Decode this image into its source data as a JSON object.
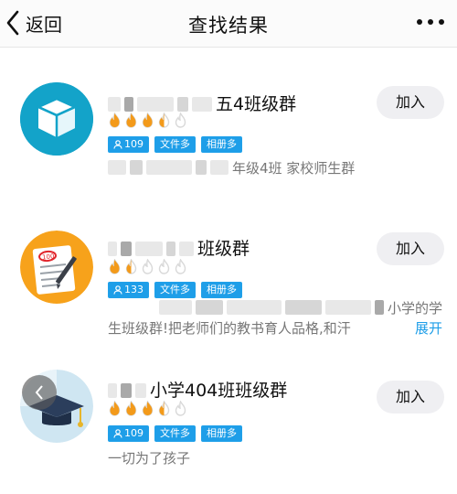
{
  "header": {
    "back_label": "返回",
    "title": "查找结果"
  },
  "groups": [
    {
      "name_visible": "五4班级群",
      "rating_filled": 3.5,
      "rating_max": 5,
      "member_count": "109",
      "tag_files": "文件多",
      "tag_album": "相册多",
      "desc_visible": "年级4班 家校师生群",
      "join_label": "加入",
      "avatar_icon": "open-box-icon"
    },
    {
      "name_visible": "班级群",
      "rating_filled": 1.5,
      "rating_max": 5,
      "member_count": "133",
      "tag_files": "文件多",
      "tag_album": "相册多",
      "desc_line1": "小学的学",
      "desc_line2": "生班级群!把老师们的教书育人品格,和汗",
      "expand_label": "展开",
      "join_label": "加入",
      "avatar_icon": "test-paper-icon"
    },
    {
      "name_visible": "小学404班班级群",
      "rating_filled": 3.5,
      "rating_max": 5,
      "member_count": "109",
      "tag_files": "文件多",
      "tag_album": "相册多",
      "desc_visible": "一切为了孩子",
      "join_label": "加入",
      "avatar_icon": "graduation-cap-icon"
    }
  ],
  "colors": {
    "accent": "#1e9ee8",
    "flame_filled": "#f39a1a",
    "flame_empty": "#d9d9d9",
    "button_bg": "#efeff2"
  }
}
